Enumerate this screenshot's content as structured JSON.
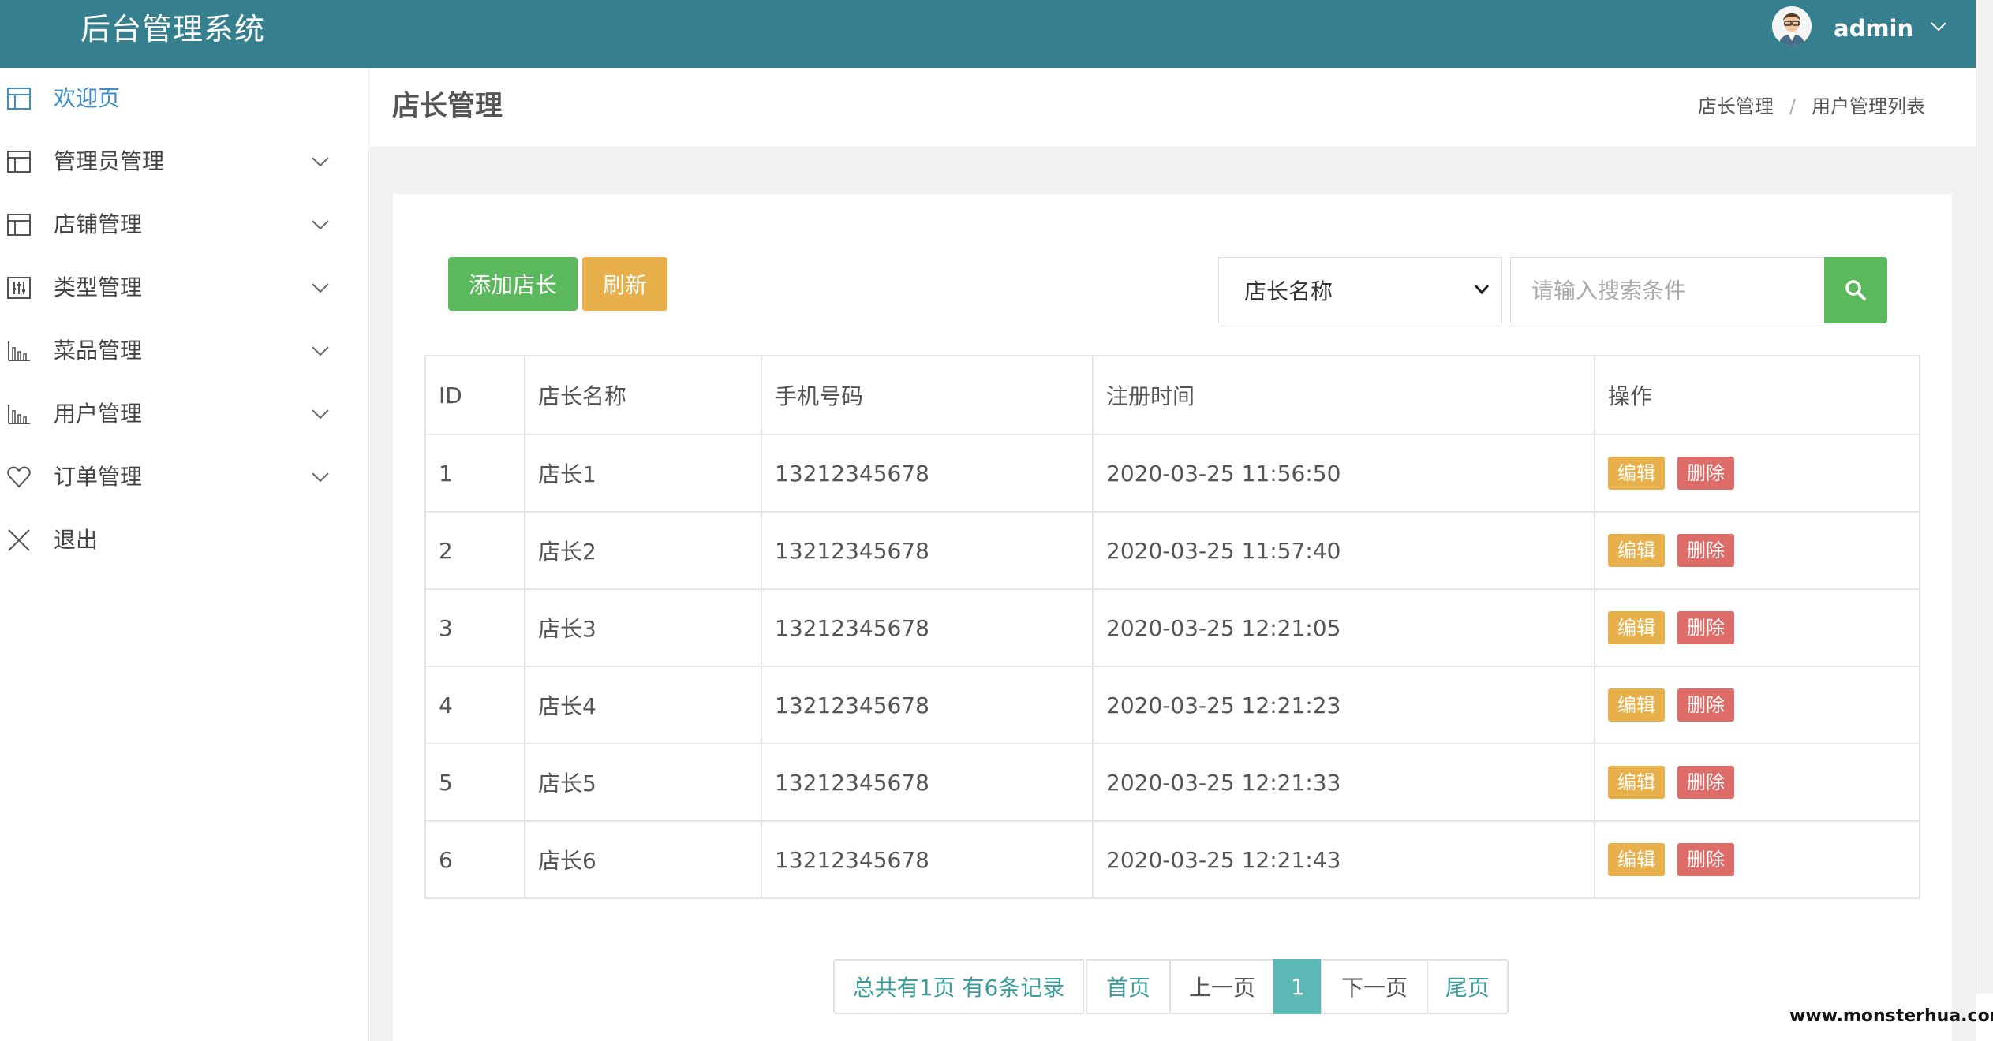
{
  "header": {
    "app_title": "后台管理系统",
    "user_name": "admin",
    "accent_color": "#367f8e"
  },
  "sidebar": {
    "items": [
      {
        "label": "欢迎页",
        "icon": "layout-icon",
        "active": true
      },
      {
        "label": "管理员管理",
        "icon": "layout-icon"
      },
      {
        "label": "店铺管理",
        "icon": "layout-icon"
      },
      {
        "label": "类型管理",
        "icon": "sliders-icon"
      },
      {
        "label": "菜品管理",
        "icon": "bar-chart-icon"
      },
      {
        "label": "用户管理",
        "icon": "bar-chart-icon"
      },
      {
        "label": "订单管理",
        "icon": "heart-icon"
      },
      {
        "label": "退出",
        "icon": "close-icon"
      }
    ]
  },
  "page": {
    "title": "店长管理",
    "breadcrumb": [
      "店长管理",
      "用户管理列表"
    ],
    "breadcrumb_sep": "/"
  },
  "toolbar": {
    "add_label": "添加店长",
    "refresh_label": "刷新",
    "search_field_selected": "店长名称",
    "search_placeholder": "请输入搜索条件"
  },
  "table": {
    "columns": [
      "ID",
      "店长名称",
      "手机号码",
      "注册时间",
      "操作"
    ],
    "rows": [
      {
        "id": "1",
        "name": "店长1",
        "phone": "13212345678",
        "time": "2020-03-25 11:56:50"
      },
      {
        "id": "2",
        "name": "店长2",
        "phone": "13212345678",
        "time": "2020-03-25 11:57:40"
      },
      {
        "id": "3",
        "name": "店长3",
        "phone": "13212345678",
        "time": "2020-03-25 12:21:05"
      },
      {
        "id": "4",
        "name": "店长4",
        "phone": "13212345678",
        "time": "2020-03-25 12:21:23"
      },
      {
        "id": "5",
        "name": "店长5",
        "phone": "13212345678",
        "time": "2020-03-25 12:21:33"
      },
      {
        "id": "6",
        "name": "店长6",
        "phone": "13212345678",
        "time": "2020-03-25 12:21:43"
      }
    ],
    "edit_label": "编辑",
    "delete_label": "删除"
  },
  "pagination": {
    "info": "总共有1页  有6条记录",
    "first": "首页",
    "prev": "上一页",
    "current": "1",
    "next": "下一页",
    "last": "尾页"
  },
  "watermark": "www.monsterhua.com"
}
